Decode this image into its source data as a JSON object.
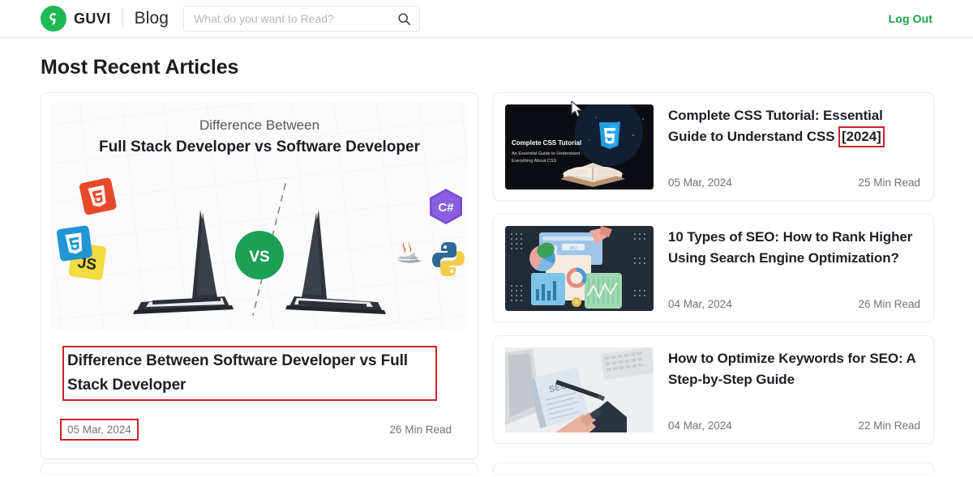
{
  "header": {
    "brand_name": "GUVI",
    "section_label": "Blog",
    "search": {
      "placeholder": "What do you want to Read?",
      "value": "",
      "icon": "search-icon"
    },
    "logout_label": "Log Out",
    "logo_icon": "guvi-logo-icon",
    "accent_color": "#1eb954",
    "logout_color": "#17a34a"
  },
  "main": {
    "page_title": "Most Recent Articles",
    "annotation_color": "#cf2026",
    "featured": {
      "hero": {
        "kicker": "Difference Between",
        "headline": "Full Stack Developer vs Software Developer",
        "badge": "VS",
        "left_tech": [
          "html5-icon",
          "js-icon",
          "css3-icon"
        ],
        "right_tech": [
          "csharp-icon",
          "java-icon",
          "python-icon"
        ],
        "csharp_label": "C#",
        "js_label": "JS",
        "badge_color": "#1ba055"
      },
      "title": "Difference Between Software Developer vs Full Stack Developer",
      "date": "05 Mar, 2024",
      "read_time": "26 Min Read",
      "title_highlighted": true,
      "date_highlighted": true
    },
    "articles": [
      {
        "title_plain": "Complete CSS Tutorial: Essential Guide to Understand CSS ",
        "title_highlight": "[2024]",
        "date": "05 Mar, 2024",
        "read_time": "25 Min Read",
        "thumb": {
          "kind": "css-tutorial-thumb",
          "overlay_title": "Complete CSS Tutorial",
          "overlay_sub_1": "An Essential Guide to Understand",
          "overlay_sub_2": "Everything About CSS",
          "bg": "#0c0d12",
          "accent": "#1f9fe0"
        }
      },
      {
        "title_plain": "10 Types of SEO: How to Rank Higher Using Search Engine Optimization?",
        "title_highlight": "",
        "date": "04 Mar, 2024",
        "read_time": "26 Min Read",
        "thumb": {
          "kind": "seo-charts-thumb",
          "overlay_title": "",
          "overlay_sub_1": "",
          "overlay_sub_2": "",
          "bg": "#222b38",
          "accent": "#49b3e0"
        }
      },
      {
        "title_plain": "How to Optimize Keywords for SEO: A Step-by-Step Guide",
        "title_highlight": "",
        "date": "04 Mar, 2024",
        "read_time": "22 Min Read",
        "thumb": {
          "kind": "desk-notebook-thumb",
          "overlay_title": "",
          "overlay_sub_1": "",
          "overlay_sub_2": "",
          "bg": "#e9eaec",
          "accent": "#2c3442"
        }
      }
    ]
  }
}
